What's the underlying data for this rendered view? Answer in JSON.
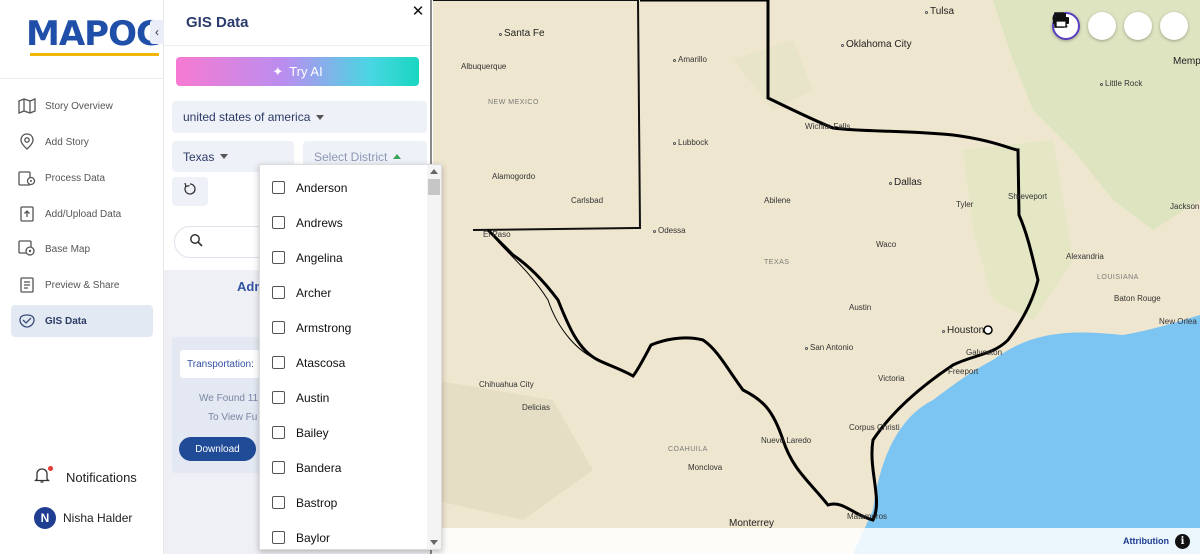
{
  "brand": {
    "logo_text_a": "MAP",
    "logo_text_b": "OG"
  },
  "nav": {
    "items": [
      {
        "label": "Story Overview",
        "icon": "map-icon"
      },
      {
        "label": "Add Story",
        "icon": "location-pin-icon"
      },
      {
        "label": "Process Data",
        "icon": "process-gear-icon"
      },
      {
        "label": "Add/Upload Data",
        "icon": "upload-icon"
      },
      {
        "label": "Base Map",
        "icon": "basemap-icon"
      },
      {
        "label": "Preview & Share",
        "icon": "preview-icon"
      },
      {
        "label": "GIS Data",
        "icon": "database-icon",
        "active": true
      }
    ],
    "notifications_label": "Notifications",
    "user_initial": "N",
    "user_name": "Nisha Halder"
  },
  "panel": {
    "title": "GIS Data",
    "try_ai_label": "Try AI",
    "country": "united states of america",
    "state": "Texas",
    "district_placeholder": "Select District",
    "search_placeholder": "",
    "admin_heading": "Adm",
    "card_tag": "Transportation:",
    "found_text": "We Found  11",
    "view_text": "To View Fu",
    "download_label": "Download"
  },
  "district_options": [
    "Anderson",
    "Andrews",
    "Angelina",
    "Archer",
    "Armstrong",
    "Atascosa",
    "Austin",
    "Bailey",
    "Bandera",
    "Bastrop",
    "Baylor"
  ],
  "map": {
    "labels": {
      "tulsa": "Tulsa",
      "santa_fe": "Santa Fe",
      "oklahoma_city": "Oklahoma City",
      "memphis": "Memph",
      "albuquerque": "Albuquerque",
      "amarillo": "Amarillo",
      "little_rock": "Little Rock",
      "new_mexico": "NEW MEXICO",
      "wichita_falls": "Wichita Falls",
      "lubbock": "Lubbock",
      "dallas": "Dallas",
      "shreveport": "Shreveport",
      "alamogordo": "Alamogordo",
      "carlsbad": "Carlsbad",
      "abilene": "Abilene",
      "tyler": "Tyler",
      "jackson": "Jackson",
      "el_paso": "El Paso",
      "odessa": "Odessa",
      "texas": "TEXAS",
      "waco": "Waco",
      "alexandria": "Alexandria",
      "louisiana": "LOUISIANA",
      "baton_rouge": "Baton Rouge",
      "austin": "Austin",
      "new_orleans": "New Orlea",
      "houston": "Houston",
      "san_antonio": "San Antonio",
      "galveston": "Galveston",
      "freeport": "Freeport",
      "chihuahua": "Chihuahua City",
      "victoria": "Victoria",
      "delicias": "Delicias",
      "corpus_christi": "Corpus Christi",
      "coahuila": "COAHUILA",
      "nuevo_laredo": "Nuevo Laredo",
      "monclova": "Monclova",
      "matamoros": "Matamoros",
      "monterrey": "Monterrey"
    },
    "attribution": "Attribution",
    "colors": {
      "land": "#efe6cf",
      "water": "#7cc4f2",
      "green": "#d6e3b8",
      "border": "#000000"
    }
  }
}
